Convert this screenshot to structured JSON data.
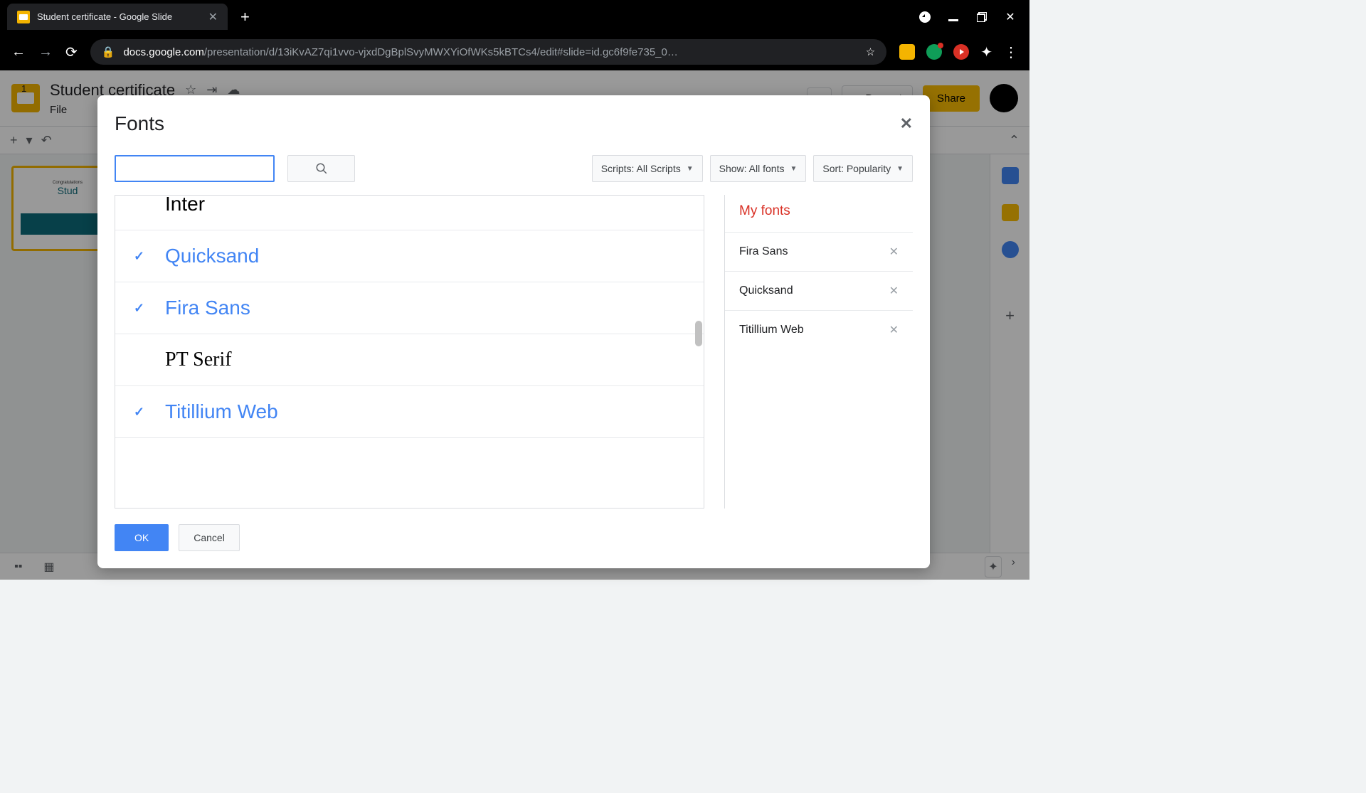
{
  "browser": {
    "tab_title": "Student certificate - Google Slide",
    "url_domain": "docs.google.com",
    "url_path": "/presentation/d/13iKvAZ7qi1vvo-vjxdDgBplSvyMWXYiOfWKs5kBTCs4/edit#slide=id.gc6f9fe735_0…"
  },
  "app": {
    "doc_title": "Student certificate",
    "menu_file": "File",
    "share_label": "Share",
    "present_label": "Present",
    "slide_number": "1",
    "thumb_line1": "Congratulations",
    "thumb_line2": "Stud"
  },
  "modal": {
    "title": "Fonts",
    "search_value": "",
    "scripts_label": "Scripts: All Scripts",
    "show_label": "Show: All fonts",
    "sort_label": "Sort: Popularity",
    "fonts": [
      {
        "name": "Inter",
        "selected": false,
        "css": ""
      },
      {
        "name": "Quicksand",
        "selected": true,
        "css": ""
      },
      {
        "name": "Fira Sans",
        "selected": true,
        "css": ""
      },
      {
        "name": "PT Serif",
        "selected": false,
        "css": "serif"
      },
      {
        "name": "Titillium Web",
        "selected": true,
        "css": ""
      }
    ],
    "my_fonts_title": "My fonts",
    "my_fonts": [
      {
        "name": "Fira Sans"
      },
      {
        "name": "Quicksand"
      },
      {
        "name": "Titillium Web"
      }
    ],
    "ok_label": "OK",
    "cancel_label": "Cancel"
  }
}
